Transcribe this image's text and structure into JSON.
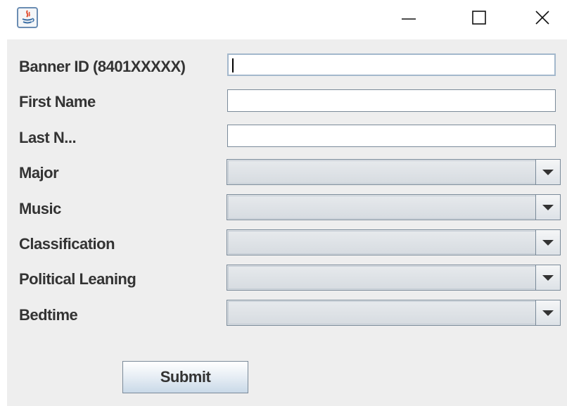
{
  "window": {
    "icon": "java-app-icon",
    "controls": {
      "minimize_icon": "minimize-icon",
      "maximize_icon": "maximize-icon",
      "close_icon": "close-icon"
    }
  },
  "form": {
    "text_fields": [
      {
        "label": "Banner ID (8401XXXXX)",
        "value": "",
        "focused": true
      },
      {
        "label": "First Name",
        "value": ""
      },
      {
        "label": "Last N...",
        "value": ""
      }
    ],
    "combos": [
      {
        "label": "Major",
        "selected": ""
      },
      {
        "label": "Music",
        "selected": ""
      },
      {
        "label": "Classification",
        "selected": ""
      },
      {
        "label": "Political Leaning",
        "selected": ""
      },
      {
        "label": "Bedtime",
        "selected": ""
      }
    ],
    "submit_label": "Submit"
  },
  "colors": {
    "panel_background": "#eeeeee",
    "label_text": "#333333",
    "field_border": "#7a8a99"
  }
}
